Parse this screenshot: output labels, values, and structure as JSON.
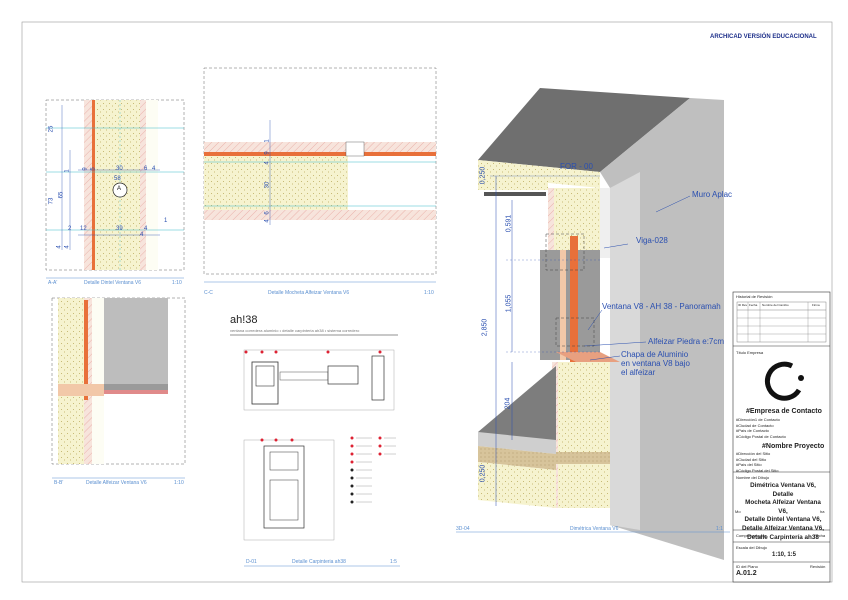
{
  "header": {
    "edition_label": "ARCHICAD VERSIÓN EDUCACIONAL"
  },
  "views": {
    "dintel": {
      "id": "A-A'",
      "title": "Detalle Dintel Ventana V6",
      "scale": "1:10"
    },
    "mocheta": {
      "id": "C-C",
      "title": "Detalle Mocheta Alfeizar Ventana V6",
      "scale": "1:10"
    },
    "alfeizar": {
      "id": "B-B'",
      "title": "Detalle Alfeizar Ventana V6",
      "scale": "1:10"
    },
    "carpinteria": {
      "id": "D-01",
      "title": "Detalle Carpinteria ah38",
      "scale": "1:5"
    },
    "dimetrica": {
      "id": "3D-04",
      "title": "Dimétrica Ventana V6",
      "scale": "1:1"
    }
  },
  "dintel_dims": [
    "25",
    "73",
    "65",
    "1",
    "9",
    "5",
    "30",
    "6",
    "4",
    "58",
    "2",
    "12",
    "39",
    "4",
    "1",
    "4",
    "4",
    "A"
  ],
  "mocheta_dims": [
    "1",
    "9",
    "4",
    "30",
    "6",
    "4"
  ],
  "carpinteria": {
    "brand": "ah!38",
    "subtitle": "ventana corredera aluminio • detalle carpinteria ah38 • sistema corredero"
  },
  "dimetrica_dims": {
    "d1": "0,250",
    "d2": "0,591",
    "d3": "1,055",
    "d4": "2,850",
    "d5": "204",
    "d6": "0,250"
  },
  "annotations": {
    "forjado": "FOR - 00",
    "muro": "Muro Aplac",
    "viga": "Viga-028",
    "ventana": "Ventana V8 - AH 38 - Panoramah",
    "alfeizar": "Alfeizar Piedra e:7cm",
    "chapa_1": "Chapa de Aluminio",
    "chapa_2": "en ventana V8 bajo",
    "chapa_3": "el alfeizar"
  },
  "revision": {
    "title": "Historial de Revisión",
    "headers": [
      "ID Rev",
      "Fecha",
      "Nombre del Cambio",
      "Firma"
    ]
  },
  "title_block": {
    "company_label": "Título Empresa",
    "contact_name": "#Empresa de Contacto",
    "contact_lines": [
      "#Dirección1 de Contacto",
      "#Ciudad de Contacto",
      "#País de Contacto",
      "#Código Postal de Contacto"
    ],
    "project_name": "#Nombre Proyecto",
    "site_lines": [
      "#Dirección del Sitio",
      "#Ciudad del Sitio",
      "#País del Sitio",
      "#Código Postal del Sitio"
    ],
    "drawing_label": "Nombre del Dibujo",
    "drawing_lines": [
      "Dimétrica Ventana V6, Detalle",
      "Mocheta Alfeizar Ventana V6,",
      "Detalle Dintel Ventana V6,",
      "Detalle Alfeizar Ventana V6,",
      "Detalle Carpintería ah38"
    ],
    "overlap_left": "Mo",
    "overlap_right": "ha",
    "checked_label": "Comprobado por",
    "date_label": "Fecha",
    "scale_label": "Escala del Dibujo",
    "scale_value": "1:10, 1:5",
    "sheet_label": "ID del Plano",
    "revision_label": "Revisión",
    "sheet_id": "A.01.2"
  }
}
